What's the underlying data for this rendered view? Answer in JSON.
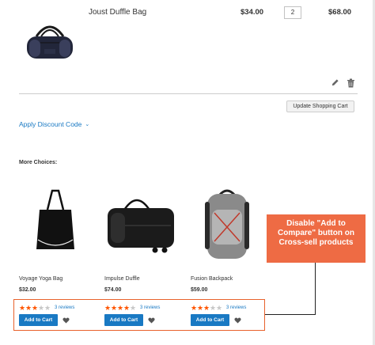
{
  "cart_item": {
    "name": "Joust Duffle Bag",
    "unit_price": "$34.00",
    "qty": "2",
    "subtotal": "$68.00"
  },
  "actions": {
    "update_cart_label": "Update Shopping Cart",
    "discount_label": "Apply Discount Code",
    "discount_icon": "chevron-down-icon"
  },
  "crosssell": {
    "heading": "More Choices:",
    "products": [
      {
        "name": "Voyage Yoga Bag",
        "price": "$32.00",
        "rating": 3,
        "reviews": "3 reviews",
        "add_label": "Add to Cart"
      },
      {
        "name": "Impulse Duffle",
        "price": "$74.00",
        "rating": 4,
        "reviews": "3 reviews",
        "add_label": "Add to Cart"
      },
      {
        "name": "Fusion Backpack",
        "price": "$59.00",
        "rating": 3,
        "reviews": "3 reviews",
        "add_label": "Add to Cart"
      }
    ]
  },
  "callout": {
    "line1": "Disable \"Add to",
    "line2": "Compare\" button on",
    "line3": "Cross-sell products"
  },
  "colors": {
    "link": "#1979c3",
    "star": "#ff5501",
    "callout_bg": "#ee6b44",
    "highlight_border": "#e8622c"
  }
}
